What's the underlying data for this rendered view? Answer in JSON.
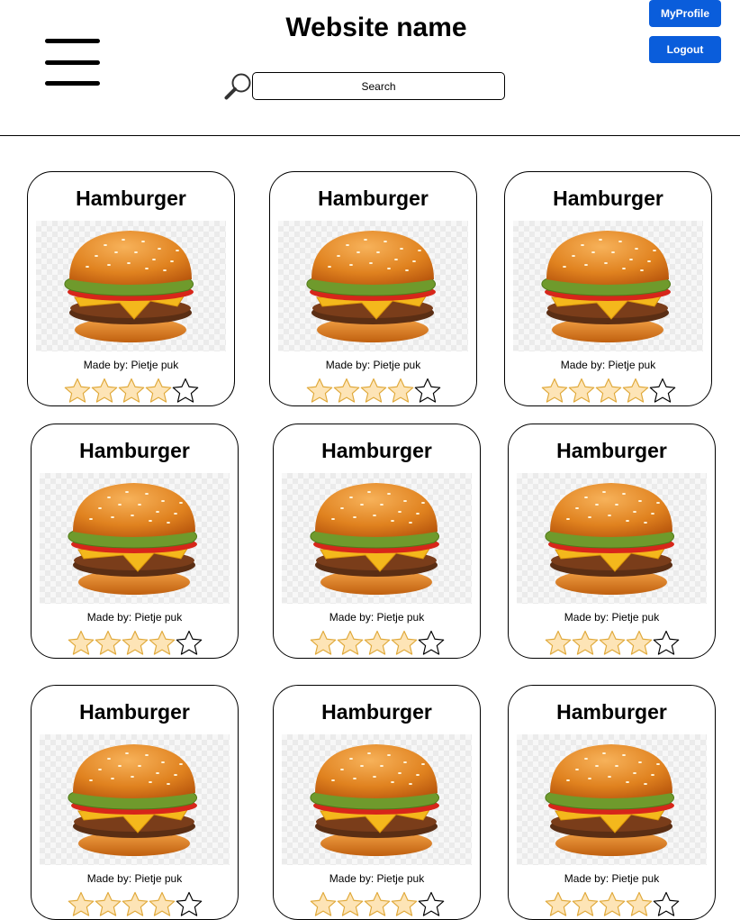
{
  "header": {
    "site_name": "Website name",
    "search_placeholder": "Search",
    "myprofile_label": "MyProfile",
    "logout_label": "Logout",
    "menu_icon": "hamburger-menu-icon",
    "search_icon": "magnifier-icon"
  },
  "colors": {
    "button_bg": "#0a5ddb",
    "star_fill": "#fde4b6",
    "star_stroke": "#e0a93a"
  },
  "recipes": [
    {
      "title": "Hamburger",
      "author": "Made by: Pietje puk",
      "rating": 4,
      "max_rating": 5
    },
    {
      "title": "Hamburger",
      "author": "Made by: Pietje puk",
      "rating": 4,
      "max_rating": 5
    },
    {
      "title": "Hamburger",
      "author": "Made by: Pietje puk",
      "rating": 4,
      "max_rating": 5
    },
    {
      "title": "Hamburger",
      "author": "Made by: Pietje puk",
      "rating": 4,
      "max_rating": 5
    },
    {
      "title": "Hamburger",
      "author": "Made by: Pietje puk",
      "rating": 4,
      "max_rating": 5
    },
    {
      "title": "Hamburger",
      "author": "Made by: Pietje puk",
      "rating": 4,
      "max_rating": 5
    },
    {
      "title": "Hamburger",
      "author": "Made by: Pietje puk",
      "rating": 4,
      "max_rating": 5
    },
    {
      "title": "Hamburger",
      "author": "Made by: Pietje puk",
      "rating": 4,
      "max_rating": 5
    },
    {
      "title": "Hamburger",
      "author": "Made by: Pietje puk",
      "rating": 4,
      "max_rating": 5
    }
  ]
}
